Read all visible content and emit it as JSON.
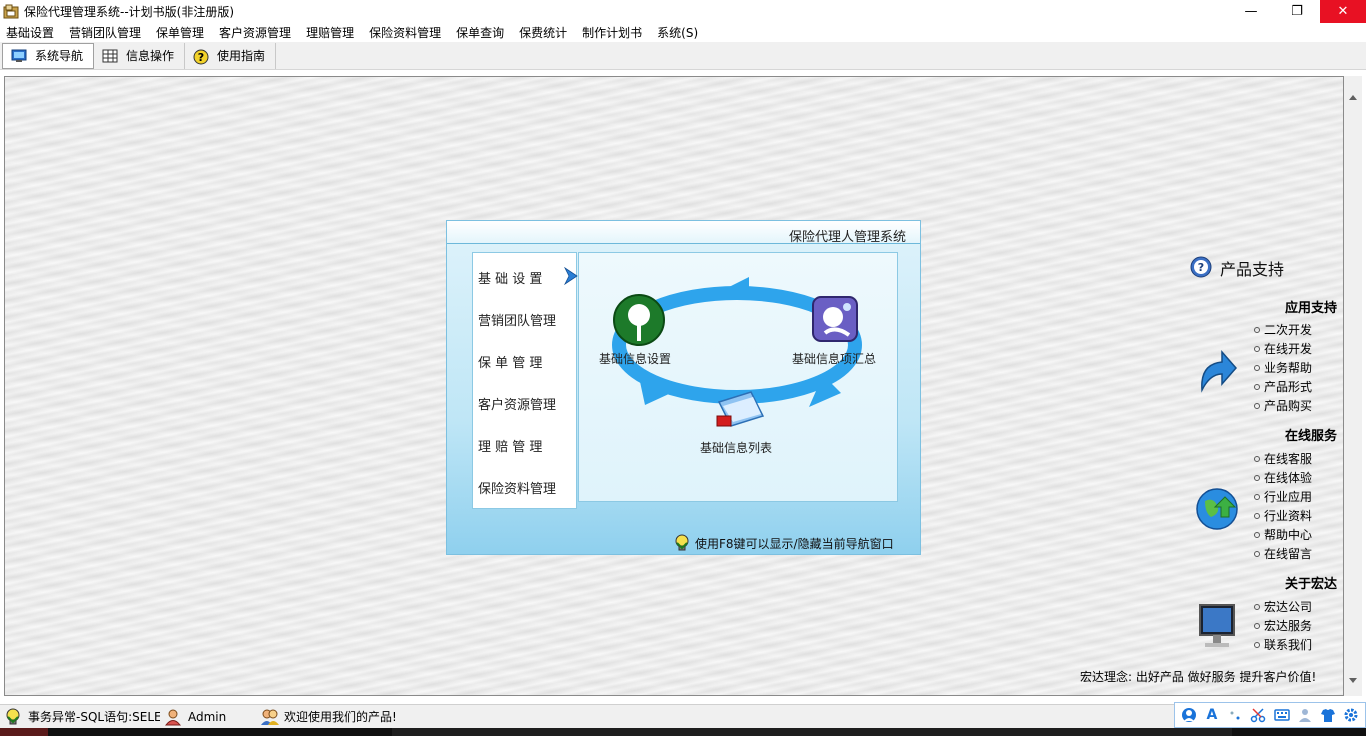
{
  "window": {
    "title": "保险代理管理系统--计划书版(非注册版)",
    "minimize_glyph": "—",
    "maximize_glyph": "❐",
    "close_glyph": "✕"
  },
  "menubar": {
    "items": [
      "基础设置",
      "营销团队管理",
      "保单管理",
      "客户资源管理",
      "理赔管理",
      "保险资料管理",
      "保单查询",
      "保费统计",
      "制作计划书",
      "系统(S)"
    ]
  },
  "toolbar": {
    "items": [
      {
        "label": "系统导航",
        "icon": "monitor-icon",
        "active": true
      },
      {
        "label": "信息操作",
        "icon": "table-icon",
        "active": false
      },
      {
        "label": "使用指南",
        "icon": "help-icon",
        "active": false
      }
    ]
  },
  "navigator": {
    "title": "保险代理人管理系统",
    "menu": [
      "基 础 设 置",
      "营销团队管理",
      "保 单 管 理",
      "客户资源管理",
      "理 赔 管 理",
      "保险资料管理"
    ],
    "selected_index": 0,
    "flow": {
      "node1": "基础信息设置",
      "node2": "基础信息项汇总",
      "node3": "基础信息列表"
    },
    "footer": "使用F8键可以显示/隐藏当前导航窗口",
    "colors": {
      "arrow": "#2ea4ec",
      "panel": "#bfe6f6"
    }
  },
  "support": {
    "title": "产品支持",
    "sections": [
      {
        "title": "应用支持",
        "icon": "arrow-curve-icon",
        "links": [
          "二次开发",
          "在线开发",
          "业务帮助",
          "产品形式",
          "产品购买"
        ]
      },
      {
        "title": "在线服务",
        "icon": "globe-icon",
        "links": [
          "在线客服",
          "在线体验",
          "行业应用",
          "行业资料",
          "帮助中心",
          "在线留言"
        ]
      },
      {
        "title": "关于宏达",
        "icon": "computer-icon",
        "links": [
          "宏达公司",
          "宏达服务",
          "联系我们"
        ]
      }
    ],
    "motto": "宏达理念: 出好产品  做好服务  提升客户价值!"
  },
  "statusbar": {
    "error_text": "事务异常-SQL语句:SELEC",
    "user": "Admin",
    "welcome": "欢迎使用我们的产品!"
  },
  "ime": {
    "mode_letter": "A"
  }
}
